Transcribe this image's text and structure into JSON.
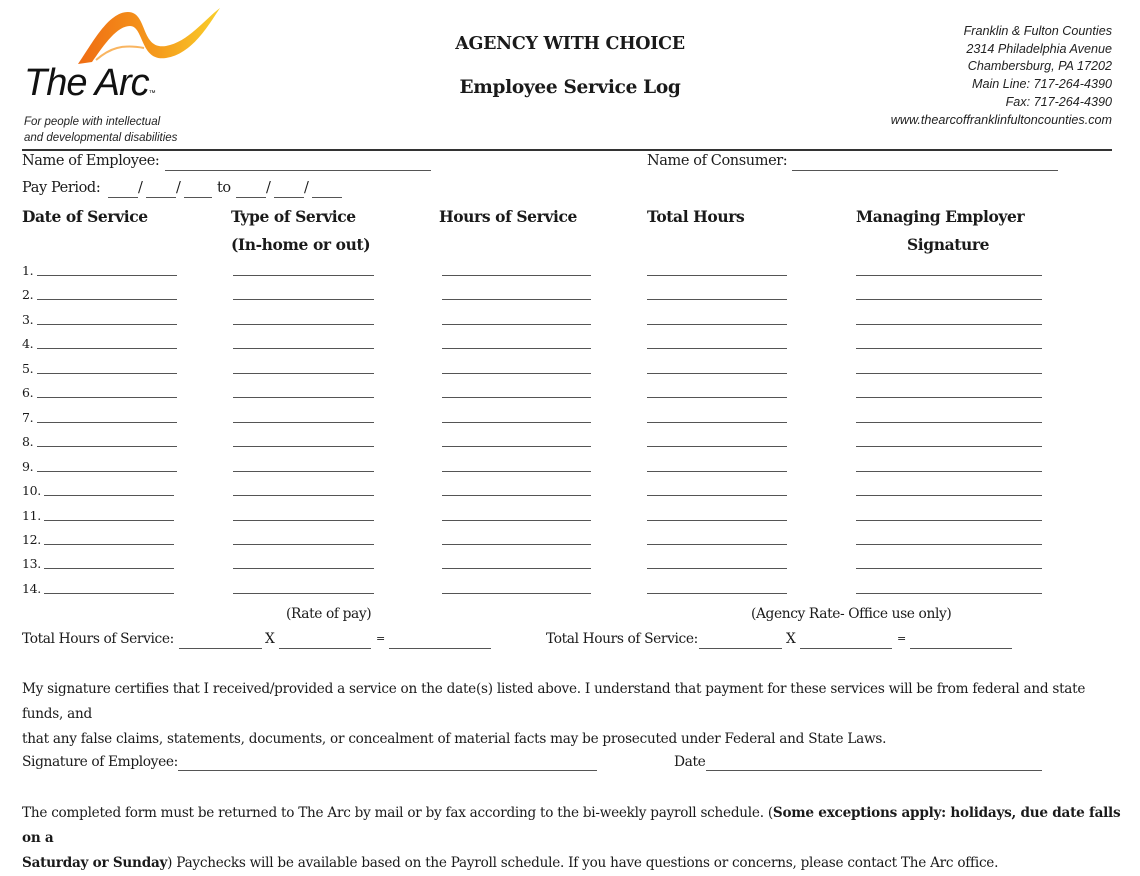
{
  "header": {
    "logo": {
      "name": "The Arc",
      "trademark": "™",
      "tagline_line1": "For people with intellectual",
      "tagline_line2": "and developmental disabilities",
      "icon": "arc-swoosh-icon",
      "colors": {
        "orange": "#f07a1a",
        "yellow": "#f9c31a"
      }
    },
    "title": "AGENCY WITH CHOICE",
    "subtitle": "Employee Service Log",
    "address": [
      "Franklin & Fulton Counties",
      "2314 Philadelphia Avenue",
      "Chambersburg, PA 17202",
      "Main Line: 717-264-4390",
      "Fax: 717-264-4390",
      "www.thearcoffranklinfultoncounties.com"
    ]
  },
  "fields": {
    "employee_label": "Name of Employee:",
    "employee_value": "",
    "consumer_label": "Name of Consumer:",
    "consumer_value": "",
    "pay_period_label": "Pay Period:",
    "pay_period_to": "to",
    "pay_period_sep": "/"
  },
  "table": {
    "columns": [
      {
        "label": "Date of Service",
        "sublabel": ""
      },
      {
        "label": "Type of Service",
        "sublabel": "(In-home or out)"
      },
      {
        "label": "Hours of Service",
        "sublabel": ""
      },
      {
        "label": "Total Hours",
        "sublabel": ""
      },
      {
        "label": "Managing Employer",
        "sublabel": "Signature"
      }
    ],
    "rows": [
      "1.",
      "2.",
      "3.",
      "4.",
      "5.",
      "6.",
      "7.",
      "8.",
      "9.",
      "10.",
      "11.",
      "12.",
      "13.",
      "14."
    ]
  },
  "totals": {
    "rate_of_pay_label": "(Rate of pay)",
    "agency_rate_label": "(Agency Rate- Office use only)",
    "total_hours_label": "Total Hours of Service:",
    "times": "X",
    "equals": "="
  },
  "certification": {
    "line1": "My signature certifies that I received/provided a service on the date(s) listed above. I understand that payment for these services will be from federal and state funds, and",
    "line2": "that any false claims, statements, documents, or concealment of material facts may be prosecuted under Federal and State Laws."
  },
  "signature": {
    "employee_label": "Signature of Employee:",
    "date_label": "Date"
  },
  "footer": {
    "line1_regular": "The completed form must be returned to The Arc by mail or by fax according to the bi-weekly payroll schedule. (",
    "line1_bold": "Some exceptions apply: holidays, due date falls on a",
    "line2_bold": "Saturday or Sunday",
    "line2_regular": ")  Paychecks will be available based on the Payroll schedule. If you have questions or concerns, please contact The Arc office."
  }
}
